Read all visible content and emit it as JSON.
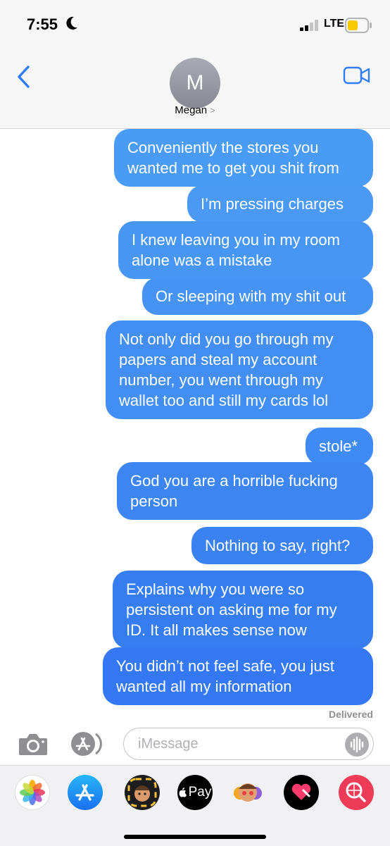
{
  "status_bar": {
    "time": "7:55",
    "network": "LTE"
  },
  "header": {
    "avatar_initial": "M",
    "contact_name": "Megan",
    "contact_chevron": ">"
  },
  "messages": [
    {
      "text_lines": [
        "Conveniently the stores you",
        "wanted me to get you shit from"
      ],
      "color": "#4a9bf5"
    },
    {
      "text_lines": [
        "I’m pressing charges"
      ],
      "color": "#4a99f4"
    },
    {
      "text_lines": [
        "I knew leaving you in my room",
        "alone was a mistake"
      ],
      "color": "#4896f4"
    },
    {
      "text_lines": [
        "Or sleeping with my shit out"
      ],
      "color": "#4693f4"
    },
    {
      "text_lines": [
        "Not only did you go through my",
        "papers and steal my account",
        "number, you went through my",
        "wallet too and still my cards lol"
      ],
      "color": "#438ef3"
    },
    {
      "text_lines": [
        "stole*"
      ],
      "color": "#408af3"
    },
    {
      "text_lines": [
        "God you are a horrible fucking",
        "person"
      ],
      "color": "#3d86f2"
    },
    {
      "text_lines": [
        "Nothing to say, right?"
      ],
      "color": "#3a82f2"
    },
    {
      "text_lines": [
        "Explains why you were so",
        "persistent on asking me for my",
        "ID. It all makes sense now"
      ],
      "color": "#377df2"
    },
    {
      "text_lines": [
        "You didn’t not feel safe, you just",
        "wanted all my information"
      ],
      "color": "#3478f6"
    }
  ],
  "delivered_label": "Delivered",
  "input": {
    "placeholder": "iMessage"
  },
  "app_drawer": {
    "apple_pay_label": "Pay",
    "icons": [
      "photos-icon",
      "app-store-icon",
      "memoji-icon",
      "apple-pay-icon",
      "memoji-stickers-icon",
      "digital-touch-icon",
      "image-search-icon"
    ]
  }
}
